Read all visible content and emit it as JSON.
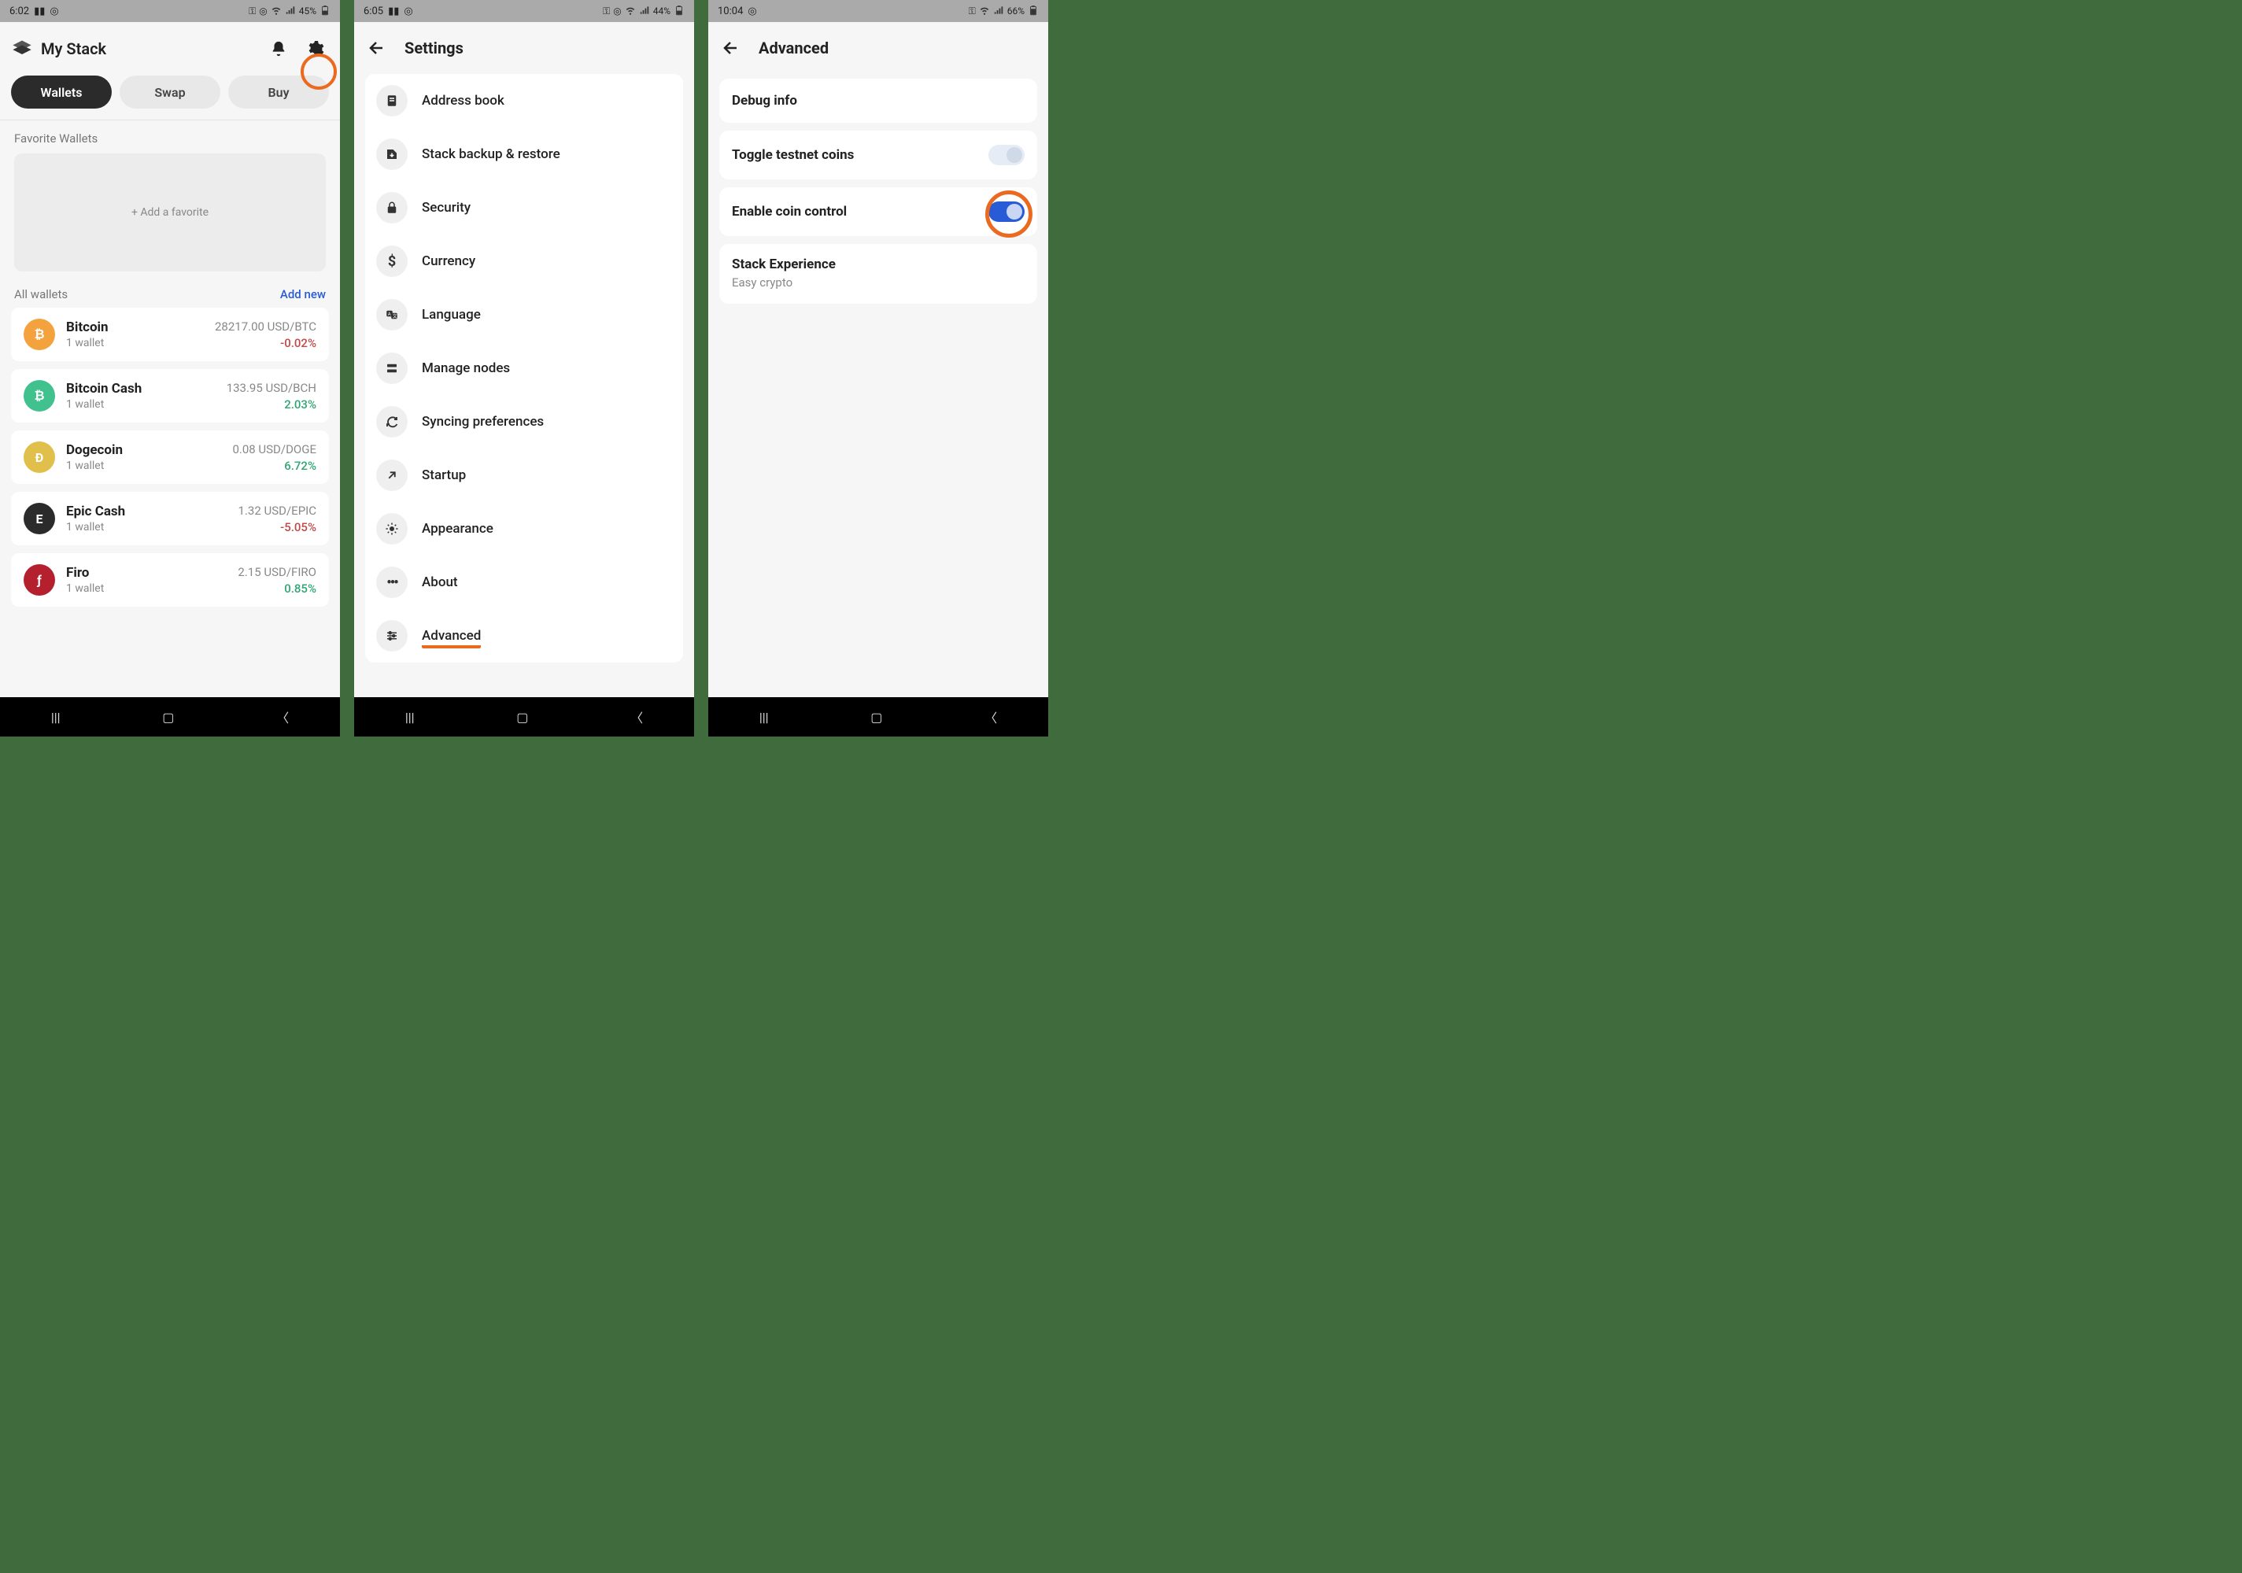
{
  "screen1": {
    "status": {
      "time": "6:02",
      "battery": "45%"
    },
    "title": "My Stack",
    "tabs": {
      "wallets": "Wallets",
      "swap": "Swap",
      "buy": "Buy"
    },
    "fav_label": "Favorite Wallets",
    "fav_placeholder": "+  Add a favorite",
    "all_label": "All wallets",
    "add_new": "Add new",
    "wallets": [
      {
        "name": "Bitcoin",
        "sub": "1 wallet",
        "price": "28217.00 USD/BTC",
        "change": "-0.02%",
        "dir": "neg",
        "color": "#f4a23e",
        "glyph": "₿"
      },
      {
        "name": "Bitcoin Cash",
        "sub": "1 wallet",
        "price": "133.95 USD/BCH",
        "change": "2.03%",
        "dir": "pos",
        "color": "#41c18e",
        "glyph": "₿"
      },
      {
        "name": "Dogecoin",
        "sub": "1 wallet",
        "price": "0.08 USD/DOGE",
        "change": "6.72%",
        "dir": "pos",
        "color": "#e0c04a",
        "glyph": "Ð"
      },
      {
        "name": "Epic Cash",
        "sub": "1 wallet",
        "price": "1.32 USD/EPIC",
        "change": "-5.05%",
        "dir": "neg",
        "color": "#2b2b2b",
        "glyph": "E"
      },
      {
        "name": "Firo",
        "sub": "1 wallet",
        "price": "2.15 USD/FIRO",
        "change": "0.85%",
        "dir": "pos",
        "color": "#b5202f",
        "glyph": "ƒ"
      }
    ]
  },
  "screen2": {
    "status": {
      "time": "6:05",
      "battery": "44%"
    },
    "title": "Settings",
    "items": [
      {
        "label": "Address book",
        "icon": "address-book-icon"
      },
      {
        "label": "Stack backup & restore",
        "icon": "backup-icon"
      },
      {
        "label": "Security",
        "icon": "lock-icon"
      },
      {
        "label": "Currency",
        "icon": "dollar-icon"
      },
      {
        "label": "Language",
        "icon": "language-icon"
      },
      {
        "label": "Manage nodes",
        "icon": "nodes-icon"
      },
      {
        "label": "Syncing preferences",
        "icon": "sync-icon"
      },
      {
        "label": "Startup",
        "icon": "startup-icon"
      },
      {
        "label": "Appearance",
        "icon": "appearance-icon"
      },
      {
        "label": "About",
        "icon": "about-icon"
      },
      {
        "label": "Advanced",
        "icon": "advanced-icon",
        "highlight": true
      }
    ]
  },
  "screen3": {
    "status": {
      "time": "10:04",
      "battery": "66%"
    },
    "title": "Advanced",
    "items": {
      "debug": "Debug info",
      "testnet": "Toggle testnet coins",
      "coin_control": "Enable coin control",
      "experience_title": "Stack Experience",
      "experience_sub": "Easy crypto"
    },
    "toggles": {
      "testnet": false,
      "coin_control": true
    }
  }
}
